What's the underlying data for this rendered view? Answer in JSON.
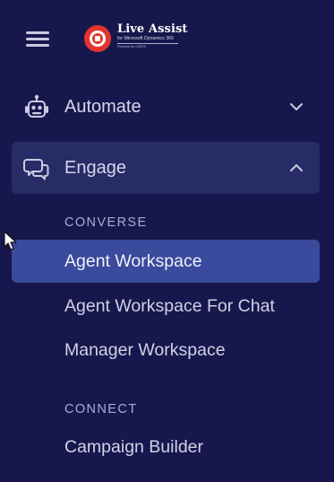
{
  "logo": {
    "title": "Live Assist",
    "subtitle": "for Microsoft Dynamics 365",
    "powered": "Powered by CAFEX"
  },
  "menu": {
    "automate": {
      "label": "Automate",
      "icon": "robot-icon",
      "expanded": false
    },
    "engage": {
      "label": "Engage",
      "icon": "chat-bubbles-icon",
      "expanded": true,
      "sections": [
        {
          "header": "CONVERSE",
          "items": [
            {
              "label": "Agent Workspace",
              "selected": true
            },
            {
              "label": "Agent Workspace For Chat",
              "selected": false
            },
            {
              "label": "Manager Workspace",
              "selected": false
            }
          ]
        },
        {
          "header": "CONNECT",
          "items": [
            {
              "label": "Campaign Builder",
              "selected": false
            }
          ]
        }
      ]
    }
  },
  "colors": {
    "background": "#17174d",
    "expanded_group_bg": "#272b66",
    "selected_item_bg": "#3a4a9c",
    "logo_red": "#e3342f"
  }
}
